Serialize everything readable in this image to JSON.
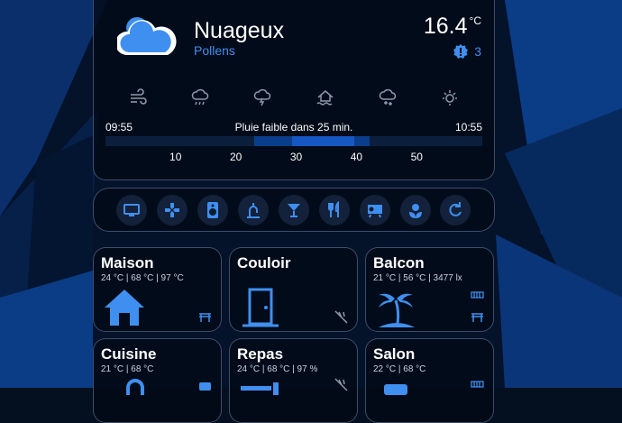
{
  "weather": {
    "condition": "Nuageux",
    "subtitle": "Pollens",
    "temperature": "16.4",
    "unit": "°C",
    "alert_count": "3",
    "forecast_icons": [
      "wind-icon",
      "rain-icon",
      "thunder-icon",
      "flood-icon",
      "snow-icon",
      "sun-icon"
    ],
    "rain": {
      "start": "09:55",
      "message": "Pluie faible dans 25 min.",
      "end": "10:55",
      "ticks": [
        "10",
        "20",
        "30",
        "40",
        "50"
      ]
    }
  },
  "quick_actions": [
    {
      "name": "tv-button",
      "icon": "monitor-icon"
    },
    {
      "name": "gamepad-button",
      "icon": "gamepad-icon"
    },
    {
      "name": "speaker-button",
      "icon": "speaker-icon"
    },
    {
      "name": "fountain-button",
      "icon": "faucet-icon"
    },
    {
      "name": "cocktail-button",
      "icon": "glass-cocktail-icon"
    },
    {
      "name": "dining-button",
      "icon": "utensils-icon"
    },
    {
      "name": "projector-button",
      "icon": "projector-icon"
    },
    {
      "name": "flower-button",
      "icon": "flower-icon"
    },
    {
      "name": "refresh-button",
      "icon": "refresh-icon"
    }
  ],
  "rooms": [
    {
      "name": "Maison",
      "info": "24 °C | 68 °C | 97 °C",
      "icon": "home-icon"
    },
    {
      "name": "Couloir",
      "info": "",
      "icon": "door-icon"
    },
    {
      "name": "Balcon",
      "info": "21 °C | 56 °C | 3477 lx",
      "icon": "palm-tree-icon"
    },
    {
      "name": "Cuisine",
      "info": "21 °C | 68 °C",
      "icon": "lock-icon"
    },
    {
      "name": "Repas",
      "info": "24 °C | 68 °C | 97 %",
      "icon": "table-icon"
    },
    {
      "name": "Salon",
      "info": "22 °C | 68 °C",
      "icon": "sofa-icon"
    }
  ],
  "colors": {
    "accent": "#3f8ff0",
    "card_bg": "#030a16",
    "border": "#8ca6d2"
  }
}
